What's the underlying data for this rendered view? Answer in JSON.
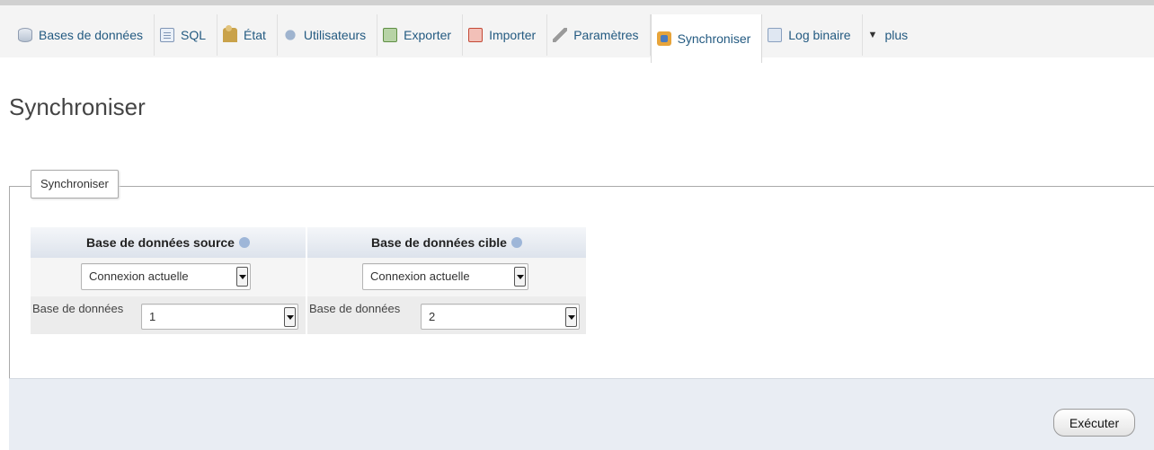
{
  "tabs": [
    {
      "label": "Bases de données",
      "icon": "database-icon"
    },
    {
      "label": "SQL",
      "icon": "sql-icon"
    },
    {
      "label": "État",
      "icon": "status-icon"
    },
    {
      "label": "Utilisateurs",
      "icon": "users-icon"
    },
    {
      "label": "Exporter",
      "icon": "export-icon"
    },
    {
      "label": "Importer",
      "icon": "import-icon"
    },
    {
      "label": "Paramètres",
      "icon": "wrench-icon"
    },
    {
      "label": "Synchroniser",
      "icon": "synchronize-icon",
      "active": true
    },
    {
      "label": "Log binaire",
      "icon": "binary-log-icon"
    },
    {
      "label": "plus",
      "icon": "triangle-down-icon"
    }
  ],
  "page": {
    "title": "Synchroniser"
  },
  "form": {
    "legend": "Synchroniser",
    "source": {
      "header": "Base de données source",
      "connection": "Connexion actuelle",
      "database_label": "Base de données",
      "database_value": "1"
    },
    "target": {
      "header": "Base de données cible",
      "connection": "Connexion actuelle",
      "database_label": "Base de données",
      "database_value": "2"
    },
    "submit_label": "Exécuter"
  },
  "colors": {
    "link": "#235a81",
    "footer_bg": "#e9edf3",
    "header_bg": "#dde3ec"
  }
}
